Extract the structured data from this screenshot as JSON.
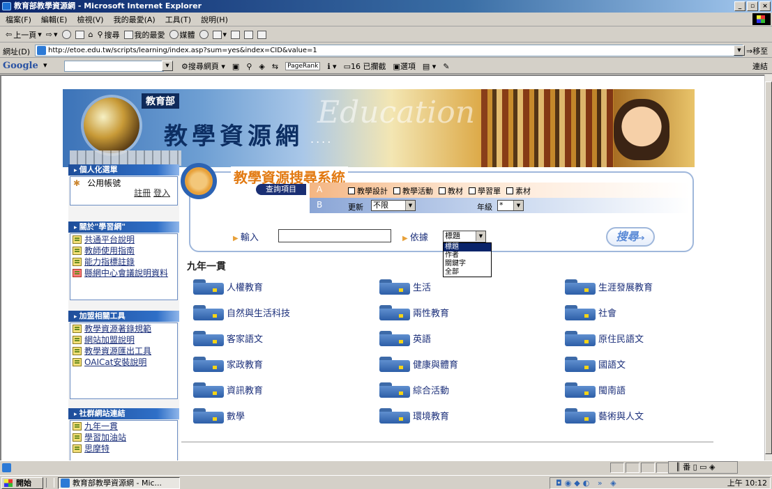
{
  "window": {
    "title": "教育部教學資源網 - Microsoft Internet Explorer",
    "buttons": [
      "_",
      "▫",
      "×"
    ]
  },
  "menu": [
    "檔案(F)",
    "編輯(E)",
    "檢視(V)",
    "我的最愛(A)",
    "工具(T)",
    "說明(H)"
  ],
  "toolbar": {
    "back": "上一頁",
    "search": "搜尋",
    "favorites": "我的最愛",
    "media": "媒體"
  },
  "address": {
    "label": "網址(D)",
    "url": "http://etoe.edu.tw/scripts/learning/index.asp?sum=yes&index=CID&value=1",
    "go": "移至"
  },
  "googlebar": {
    "logo": "Google",
    "search_web": "搜尋網頁",
    "pagerank": "PageRank",
    "blocked": "16 已攔截",
    "options": "選項",
    "links": "連結"
  },
  "banner": {
    "ministry": "教育部",
    "title": "教學資源網",
    "dots": "....",
    "watermark": "Education"
  },
  "sidebar": {
    "personal": {
      "header": "個人化選單",
      "account": "公用帳號",
      "register": "註冊",
      "login": "登入"
    },
    "about": {
      "header": "關於\"學習網\"",
      "items": [
        "共通平台說明",
        "教師使用指南",
        "能力指標註錄",
        "縣網中心會議說明資料"
      ]
    },
    "tools": {
      "header": "加盟相關工具",
      "items": [
        "教學資源著錄規範",
        "網站加盟說明",
        "教學資源匯出工具",
        "OAICat安裝說明"
      ]
    },
    "community": {
      "header": "社群網站連結",
      "items": [
        "九年一貫",
        "學習加油站",
        "思摩特"
      ]
    }
  },
  "search": {
    "title": "教學資源搜尋系統",
    "query_label": "查詢項目",
    "rowA": "A",
    "rowB": "B",
    "types": [
      "教學設計",
      "教學活動",
      "教材",
      "學習單",
      "素材"
    ],
    "update_label": "更新",
    "update_value": "不限",
    "grade_label": "年級",
    "grade_value": "*",
    "input_label": "輸入",
    "by_label": "依據",
    "by_value": "標題",
    "by_options": [
      "標題",
      "作者",
      "關鍵字",
      "全部"
    ],
    "button": "搜尋"
  },
  "section": {
    "title": "九年一貫"
  },
  "categories": [
    "人權教育",
    "生活",
    "生涯發展教育",
    "自然與生活科技",
    "兩性教育",
    "社會",
    "客家語文",
    "英語",
    "原住民語文",
    "家政教育",
    "健康與體育",
    "國語文",
    "資訊教育",
    "綜合活動",
    "閩南語",
    "數學",
    "環境教育",
    "藝術與人文"
  ],
  "status": {
    "ime": "║ 番 ▯ ▭ ◈"
  },
  "taskbar": {
    "start": "開始",
    "task": "教育部教學資源網 - Mic...",
    "tray_icons": "◘◉◆◐ » ◈",
    "clock": "上午 10:12"
  }
}
